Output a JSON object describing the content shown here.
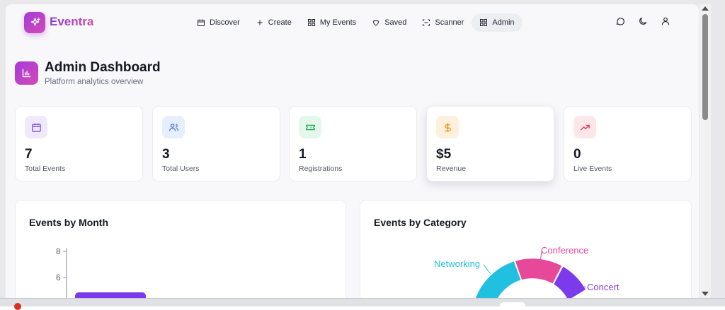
{
  "brand": {
    "name": "Eventra"
  },
  "nav": {
    "items": [
      {
        "label": "Discover",
        "icon": "calendar-icon"
      },
      {
        "label": "Create",
        "icon": "plus-icon"
      },
      {
        "label": "My Events",
        "icon": "grid-icon"
      },
      {
        "label": "Saved",
        "icon": "heart-icon"
      },
      {
        "label": "Scanner",
        "icon": "scan-icon"
      },
      {
        "label": "Admin",
        "icon": "grid-icon",
        "active": true
      }
    ],
    "right_icons": [
      "chat-icon",
      "moon-icon",
      "user-icon"
    ]
  },
  "header": {
    "title": "Admin Dashboard",
    "subtitle": "Platform analytics overview"
  },
  "stats": [
    {
      "value": "7",
      "label": "Total Events",
      "icon": "calendar-icon",
      "bg": "#efe9fb",
      "fg": "#7c4bd9"
    },
    {
      "value": "3",
      "label": "Total Users",
      "icon": "users-icon",
      "bg": "#e6efff",
      "fg": "#3b72e8"
    },
    {
      "value": "1",
      "label": "Registrations",
      "icon": "ticket-icon",
      "bg": "#e3f8ea",
      "fg": "#22a654"
    },
    {
      "value": "$5",
      "label": "Revenue",
      "icon": "dollar-icon",
      "bg": "#fdf1dd",
      "fg": "#e8900c"
    },
    {
      "value": "0",
      "label": "Live Events",
      "icon": "trending-up-icon",
      "bg": "#fde7ea",
      "fg": "#e53950"
    }
  ],
  "panels": {
    "by_month": {
      "title": "Events by Month"
    },
    "by_category": {
      "title": "Events by Category"
    }
  },
  "chart_data": [
    {
      "type": "bar",
      "title": "Events by Month",
      "yticks": [
        "8",
        "6"
      ],
      "ylim": [
        0,
        8
      ],
      "bar_color": "#7c3aed"
    },
    {
      "type": "pie",
      "title": "Events by Category",
      "labels": [
        "Networking",
        "Conference",
        "Concert"
      ],
      "colors": [
        "#22c0e0",
        "#e8489a",
        "#7c3aed"
      ]
    }
  ]
}
